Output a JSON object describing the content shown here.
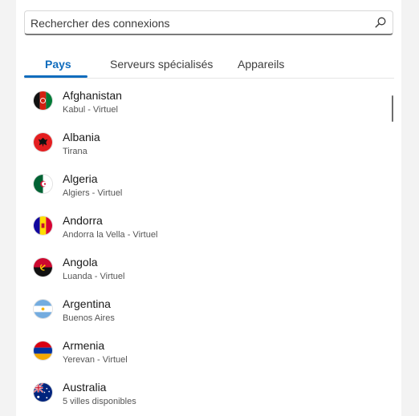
{
  "search": {
    "placeholder": "Rechercher des connexions"
  },
  "tabs": [
    {
      "label": "Pays",
      "active": true
    },
    {
      "label": "Serveurs spécialisés",
      "active": false
    },
    {
      "label": "Appareils",
      "active": false
    }
  ],
  "countries": [
    {
      "name": "Afghanistan",
      "sub": "Kabul - Virtuel",
      "flag": "afghanistan-flag-icon"
    },
    {
      "name": "Albania",
      "sub": "Tirana",
      "flag": "albania-flag-icon"
    },
    {
      "name": "Algeria",
      "sub": "Algiers - Virtuel",
      "flag": "algeria-flag-icon"
    },
    {
      "name": "Andorra",
      "sub": "Andorra la Vella - Virtuel",
      "flag": "andorra-flag-icon"
    },
    {
      "name": "Angola",
      "sub": "Luanda - Virtuel",
      "flag": "angola-flag-icon"
    },
    {
      "name": "Argentina",
      "sub": "Buenos Aires",
      "flag": "argentina-flag-icon"
    },
    {
      "name": "Armenia",
      "sub": "Yerevan - Virtuel",
      "flag": "armenia-flag-icon"
    },
    {
      "name": "Australia",
      "sub": "5 villes disponibles",
      "flag": "australia-flag-icon"
    }
  ],
  "colors": {
    "accent": "#0f6cbd"
  }
}
